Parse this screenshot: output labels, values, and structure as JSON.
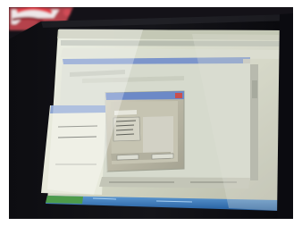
{
  "photo": {
    "subject": "",
    "colors": {
      "background": "#151318",
      "bezel": "#07070b",
      "screen_glow": "#d8dccb",
      "window_face": "#c9cbb8",
      "titlebar": "#6f8bc6",
      "dialog_face": "#b7b4a4",
      "taskbar": "#2d6fb2",
      "red_accent": "#b83b45"
    },
    "texts": []
  }
}
